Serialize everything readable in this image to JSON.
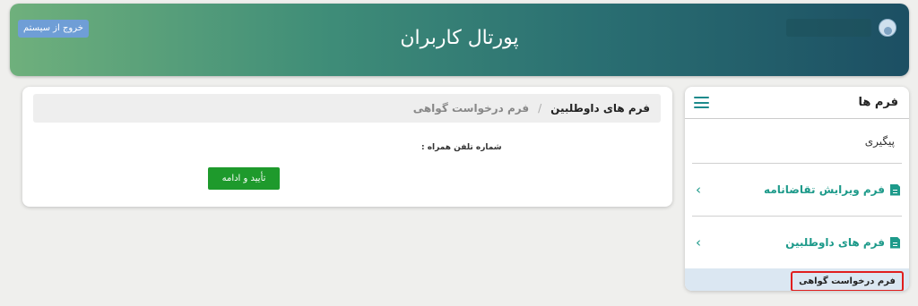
{
  "header": {
    "title": "پورتال کاربران",
    "logout_label": "خروج از سیستم"
  },
  "sidebar": {
    "heading": "فرم ها",
    "tracking_label": "پیگیری",
    "groups": [
      {
        "label": "فرم ویرایش تقاضانامه"
      },
      {
        "label": "فرم های داوطلبین"
      }
    ],
    "selected_subitem": "فرم درخواست گواهی"
  },
  "breadcrumb": {
    "parent": "فرم های داوطلبین",
    "separator": "/",
    "current": "فرم درخواست گواهی"
  },
  "form": {
    "phone_label": "شماره تلفن همراه :",
    "confirm_label": "تأیید و ادامه"
  },
  "colors": {
    "accent": "#1d9a8a",
    "confirm": "#1e9a2c",
    "highlight_border": "#e01e1e"
  },
  "icons": [
    "menu-icon",
    "document-icon",
    "chevron-right-icon",
    "avatar-icon"
  ]
}
